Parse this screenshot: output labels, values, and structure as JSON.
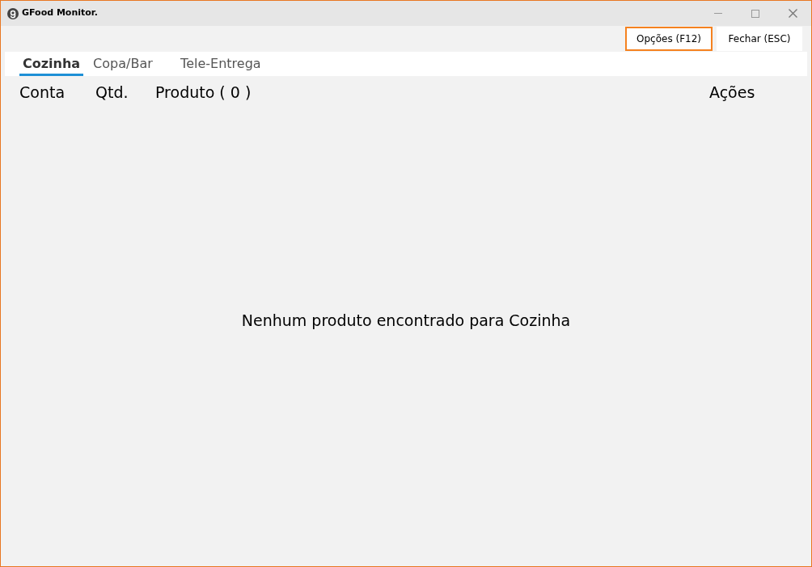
{
  "window": {
    "title": "GFood Monitor."
  },
  "toolbar": {
    "buttons": [
      {
        "label": "Opções (F12)",
        "focused": true
      },
      {
        "label": "Fechar (ESC)",
        "focused": false
      }
    ]
  },
  "tabs": [
    {
      "label": "Cozinha",
      "selected": true
    },
    {
      "label": "Copa/Bar",
      "selected": false
    },
    {
      "label": "Tele-Entrega",
      "selected": false
    }
  ],
  "table": {
    "columns": [
      "Conta",
      "Qtd.",
      "Produto ( 0 )",
      "Ações"
    ]
  },
  "empty_message": "Nenhum produto encontrado para Cozinha"
}
